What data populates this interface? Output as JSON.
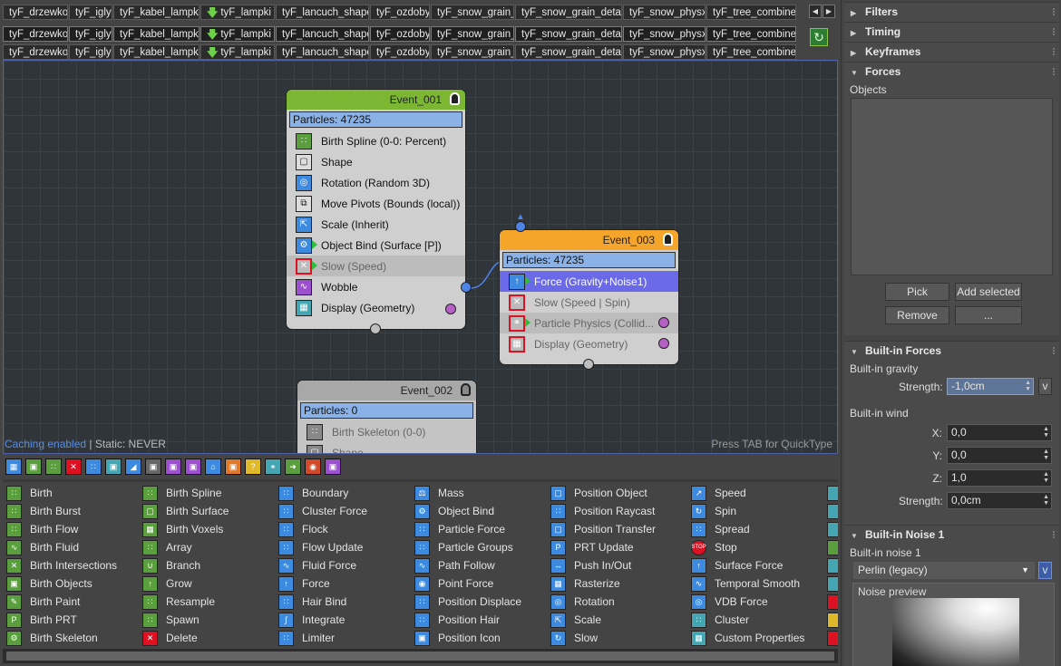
{
  "tabs": [
    "tyF_drzewko",
    "tyF_igly",
    "tyF_kabel_lampki",
    "tyF_lampki",
    "tyF_lancuch_shape",
    "tyF_ozdoby",
    "tyF_snow_grain_",
    "tyF_snow_grain_detai",
    "tyF_snow_physx",
    "tyF_tree_combine"
  ],
  "nodes": {
    "event1": {
      "title": "Event_001",
      "particles": "Particles: 47235",
      "ops": [
        "Birth Spline (0-0: Percent)",
        "Shape",
        "Rotation (Random 3D)",
        "Move Pivots (Bounds (local))",
        "Scale (Inherit)",
        "Object Bind (Surface [P])",
        "Slow (Speed)",
        "Wobble",
        "Display (Geometry)"
      ]
    },
    "event3": {
      "title": "Event_003",
      "particles": "Particles: 47235",
      "ops": [
        "Force (Gravity+Noise1)",
        "Slow (Speed | Spin)",
        "Particle Physics (Collid...",
        "Display (Geometry)"
      ]
    },
    "event2": {
      "title": "Event_002",
      "particles": "Particles: 0",
      "ops": [
        "Birth Skeleton (0-0)",
        "Shape"
      ]
    }
  },
  "status": {
    "caching": "Caching enabled",
    "sep": " | ",
    "static": "Static: NEVER",
    "hint": "Press TAB for QuickType"
  },
  "operators": {
    "col1": [
      "Birth",
      "Birth Burst",
      "Birth Flow",
      "Birth Fluid",
      "Birth Intersections",
      "Birth Objects",
      "Birth Paint",
      "Birth PRT",
      "Birth Skeleton"
    ],
    "col2": [
      "Birth Spline",
      "Birth Surface",
      "Birth Voxels",
      "Array",
      "Branch",
      "Grow",
      "Resample",
      "Spawn",
      "Delete"
    ],
    "col3": [
      "Boundary",
      "Cluster Force",
      "Flock",
      "Flow Update",
      "Fluid Force",
      "Force",
      "Hair Bind",
      "Integrate",
      "Limiter"
    ],
    "col4": [
      "Mass",
      "Object Bind",
      "Particle Force",
      "Particle Groups",
      "Path Follow",
      "Point Force",
      "Position Displace",
      "Position Hair",
      "Position Icon"
    ],
    "col5": [
      "Position Object",
      "Position Raycast",
      "Position Transfer",
      "PRT Update",
      "Push In/Out",
      "Rasterize",
      "Rotation",
      "Scale",
      "Slow"
    ],
    "col6": [
      "Speed",
      "Spin",
      "Spread",
      "Stop",
      "Surface Force",
      "Temporal Smooth",
      "VDB Force",
      "Cluster",
      "Custom Properties"
    ]
  },
  "panel": {
    "filters": "Filters",
    "timing": "Timing",
    "keyframes": "Keyframes",
    "forces": "Forces",
    "objects_label": "Objects",
    "pick": "Pick",
    "add_selected": "Add selected",
    "remove": "Remove",
    "more": "...",
    "builtin_forces": "Built-in Forces",
    "builtin_gravity": "Built-in gravity",
    "strength_label": "Strength:",
    "gravity_strength": "-1,0cm",
    "v_btn": "v",
    "builtin_wind": "Built-in wind",
    "x_label": "X:",
    "x_val": "0,0",
    "y_label": "Y:",
    "y_val": "0,0",
    "z_label": "Z:",
    "z_val": "1,0",
    "wind_strength": "0,0cm",
    "builtin_noise": "Built-in Noise 1",
    "noise_label": "Built-in noise 1",
    "noise_type": "Perlin (legacy)",
    "noise_preview": "Noise preview"
  },
  "colors": {
    "event1_head": "#7cb733",
    "event3_head": "#f5a52a",
    "event2_head": "#a8a8a8",
    "accent": "#5a8ce0"
  }
}
